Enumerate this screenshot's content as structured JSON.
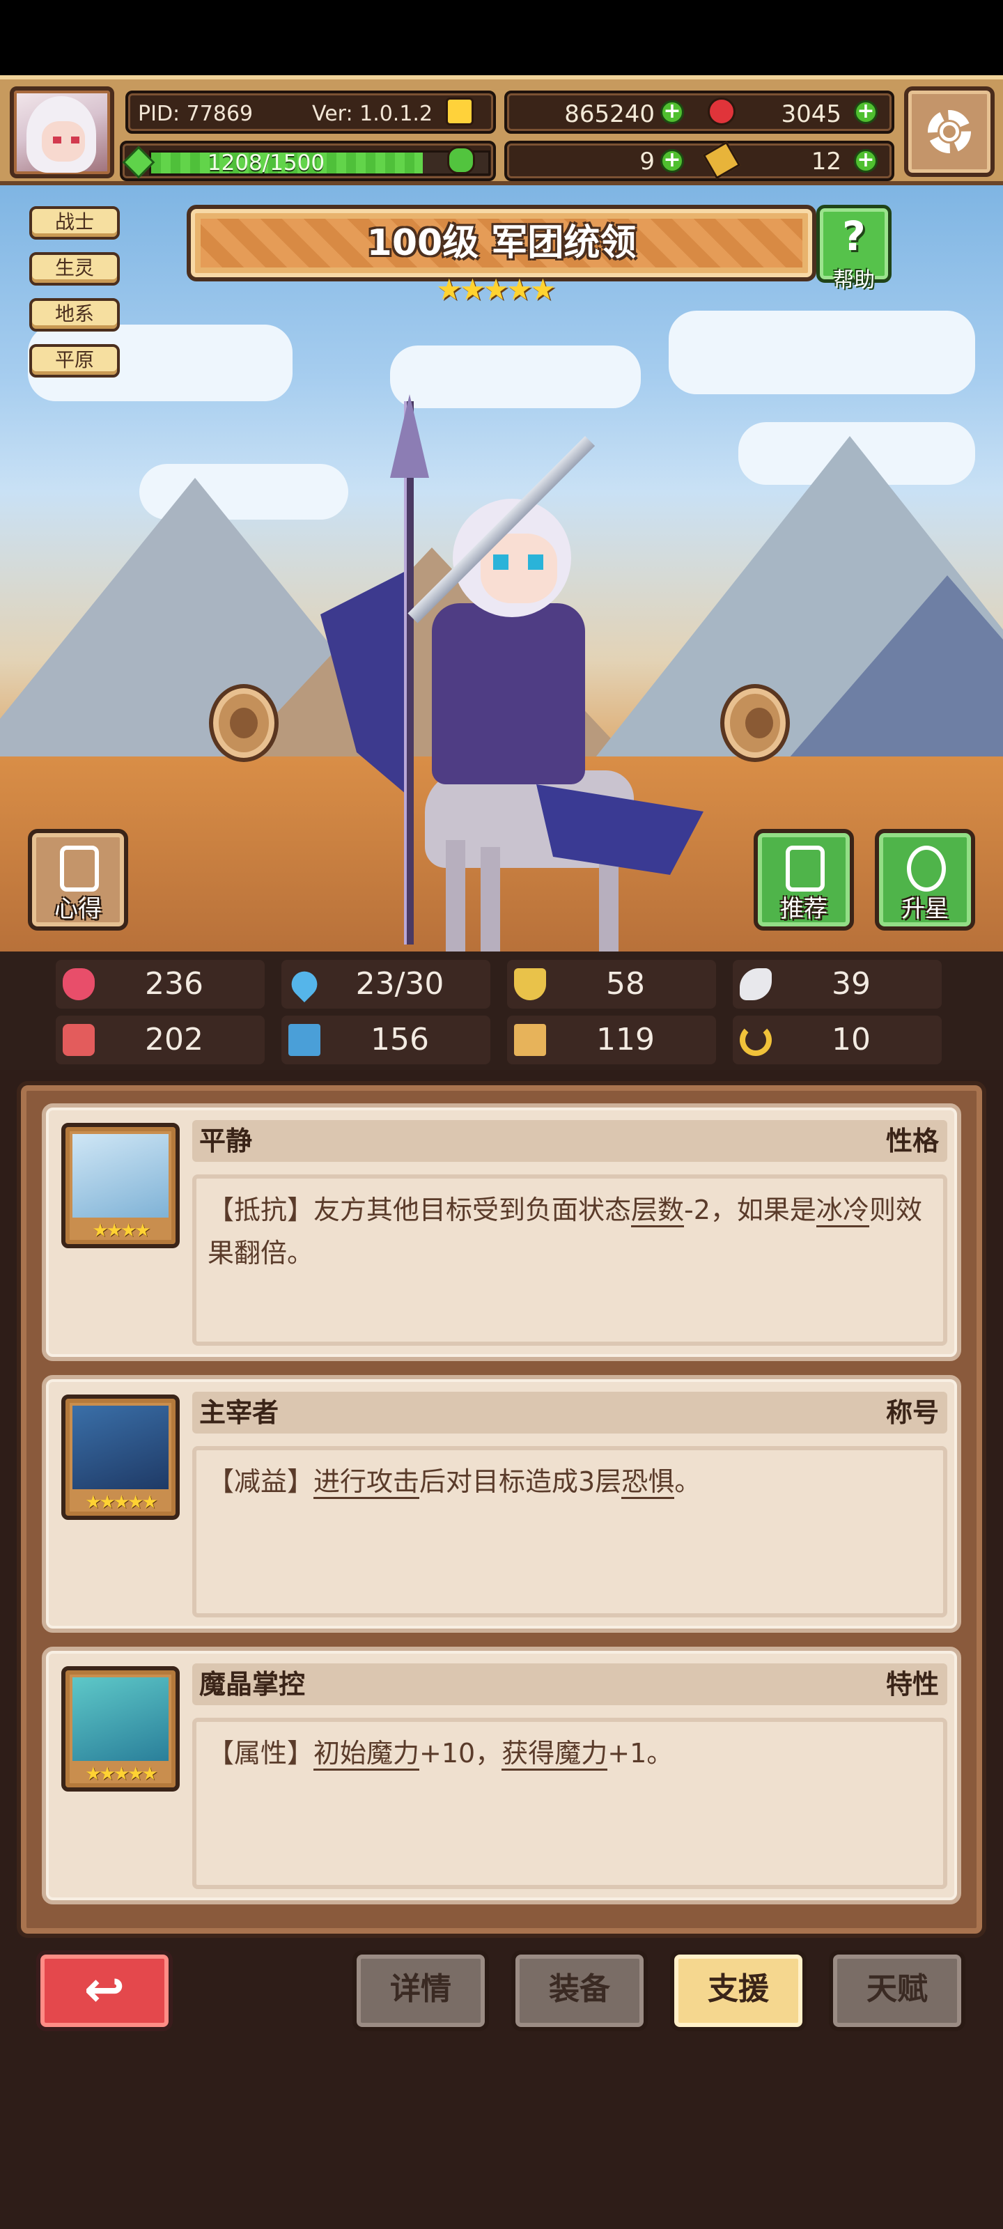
{
  "header": {
    "pid": "PID: 77869",
    "version": "Ver: 1.0.1.2",
    "energy": {
      "text": "1208/1500",
      "current": 1208,
      "max": 1500
    },
    "gold": "865240",
    "gems": "3045",
    "clover": "9",
    "keys": "12",
    "icons": {
      "gold": "gold-coin-icon",
      "gems": "red-gem-icon",
      "clover": "clover-icon",
      "keys": "key-icon",
      "energy": "energy-icon",
      "settings": "settings-icon"
    }
  },
  "tags": [
    "战士",
    "生灵",
    "地系",
    "平原"
  ],
  "hero": {
    "title": "100级 军团统领",
    "stars": "★★★★★",
    "star_count": 5
  },
  "help_label": "帮助",
  "side_buttons": {
    "insight": "心得",
    "recommend": "推荐",
    "upgrade": "升星"
  },
  "stats": [
    {
      "icon": "heart-icon",
      "value": "236"
    },
    {
      "icon": "water-drop-icon",
      "value": "23/30"
    },
    {
      "icon": "shield-icon",
      "value": "58"
    },
    {
      "icon": "wing-icon",
      "value": "39"
    },
    {
      "icon": "fist-icon",
      "value": "202"
    },
    {
      "icon": "book-icon",
      "value": "156"
    },
    {
      "icon": "boot-icon",
      "value": "119"
    },
    {
      "icon": "horseshoe-icon",
      "value": "10"
    }
  ],
  "traits": [
    {
      "name": "平静",
      "type": "性格",
      "stars": "★★★★",
      "desc_parts": [
        "【抵抗】友方其他目标受到负面状态",
        "层数",
        "-2，如果是",
        "冰冷",
        "则效果翻倍。"
      ]
    },
    {
      "name": "主宰者",
      "type": "称号",
      "stars": "★★★★★",
      "desc_parts": [
        "【减益】",
        "进行攻击",
        "后对目标造成3层",
        "恐惧",
        "。"
      ]
    },
    {
      "name": "魔晶掌控",
      "type": "特性",
      "stars": "★★★★★",
      "desc_parts": [
        "【属性】",
        "初始魔力",
        "+10，",
        "获得魔力",
        "+1。"
      ]
    }
  ],
  "bottom_tabs": [
    "详情",
    "装备",
    "支援",
    "天赋"
  ],
  "active_tab": "支援",
  "colors": {
    "accent_green": "#56c24b",
    "back_red": "#e4484c",
    "active_tab": "#f5d78f",
    "star": "#ffd233"
  }
}
